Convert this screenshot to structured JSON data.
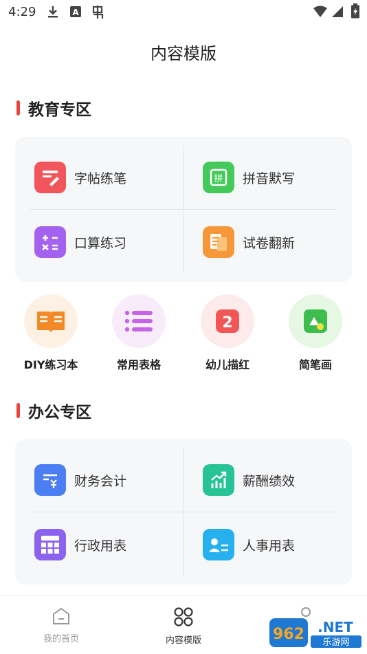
{
  "status_bar": {
    "time": "4:29",
    "left_icons": [
      "download-icon",
      "a-letter-icon",
      "bug-icon"
    ],
    "right_icons": [
      "wifi-icon",
      "signal-icon",
      "battery-icon"
    ]
  },
  "header": {
    "title": "内容模版"
  },
  "education": {
    "title": "教育专区",
    "items": [
      {
        "label": "字帖练笔",
        "icon": "pen-paper-icon",
        "color": "#f0565b"
      },
      {
        "label": "拼音默写",
        "icon": "pinyin-icon",
        "color": "#45c95a"
      },
      {
        "label": "口算练习",
        "icon": "calculator-icon",
        "color": "#a562f0"
      },
      {
        "label": "试卷翻新",
        "icon": "documents-icon",
        "color": "#f6973a"
      }
    ]
  },
  "quick_tools": [
    {
      "label": "DIY练习本",
      "icon": "open-book-icon",
      "bg": "#fdf1e4",
      "color": "#f38a26"
    },
    {
      "label": "常用表格",
      "icon": "list-icon",
      "bg": "#f8ecfb",
      "color": "#c365e6"
    },
    {
      "label": "幼儿描红",
      "icon": "number-two-icon",
      "bg": "#fdebeb",
      "color": "#f25656"
    },
    {
      "label": "简笔画",
      "icon": "shapes-icon",
      "bg": "#e6f7e4",
      "color": "#3cbd4d"
    }
  ],
  "office": {
    "title": "办公专区",
    "items": [
      {
        "label": "财务会计",
        "icon": "finance-icon",
        "color": "#4c7ef3"
      },
      {
        "label": "薪酬绩效",
        "icon": "growth-chart-icon",
        "color": "#27c397"
      },
      {
        "label": "行政用表",
        "icon": "table-grid-icon",
        "color": "#8b63ee"
      },
      {
        "label": "人事用表",
        "icon": "id-card-icon",
        "color": "#26b1ee"
      }
    ]
  },
  "tab_bar": {
    "items": [
      {
        "label": "我的首页",
        "icon": "home-icon",
        "active": false
      },
      {
        "label": "内容模版",
        "icon": "template-grid-icon",
        "active": true
      },
      {
        "label": "",
        "icon": "profile-icon",
        "active": false
      }
    ]
  },
  "watermark": {
    "text_top": "962.NET",
    "text_bottom": "乐游网"
  }
}
